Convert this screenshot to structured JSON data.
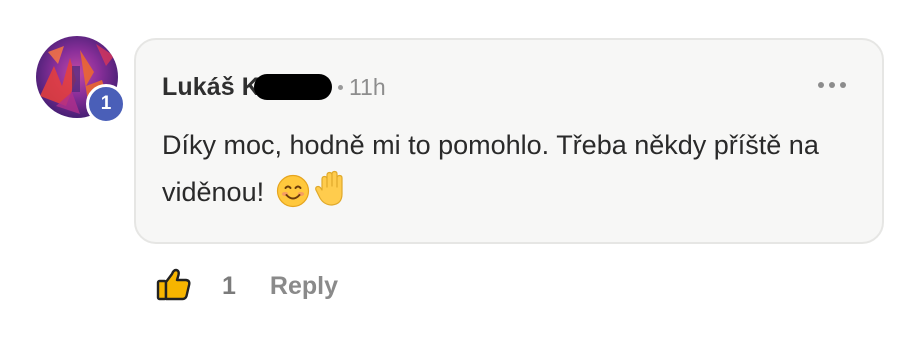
{
  "comment": {
    "author": "Lukáš K",
    "time": "11h",
    "text": "Díky moc, hodně mi to pomohlo. Třeba někdy příště na viděnou!",
    "emojis": [
      "smiling-face-icon",
      "raised-hand-icon"
    ],
    "badge_count": "1"
  },
  "actions": {
    "like_count": "1",
    "reply_label": "Reply"
  },
  "colors": {
    "bubble_background": "#f7f7f6",
    "badge": "#4a5fb8",
    "muted_text": "#8a8a8a"
  }
}
